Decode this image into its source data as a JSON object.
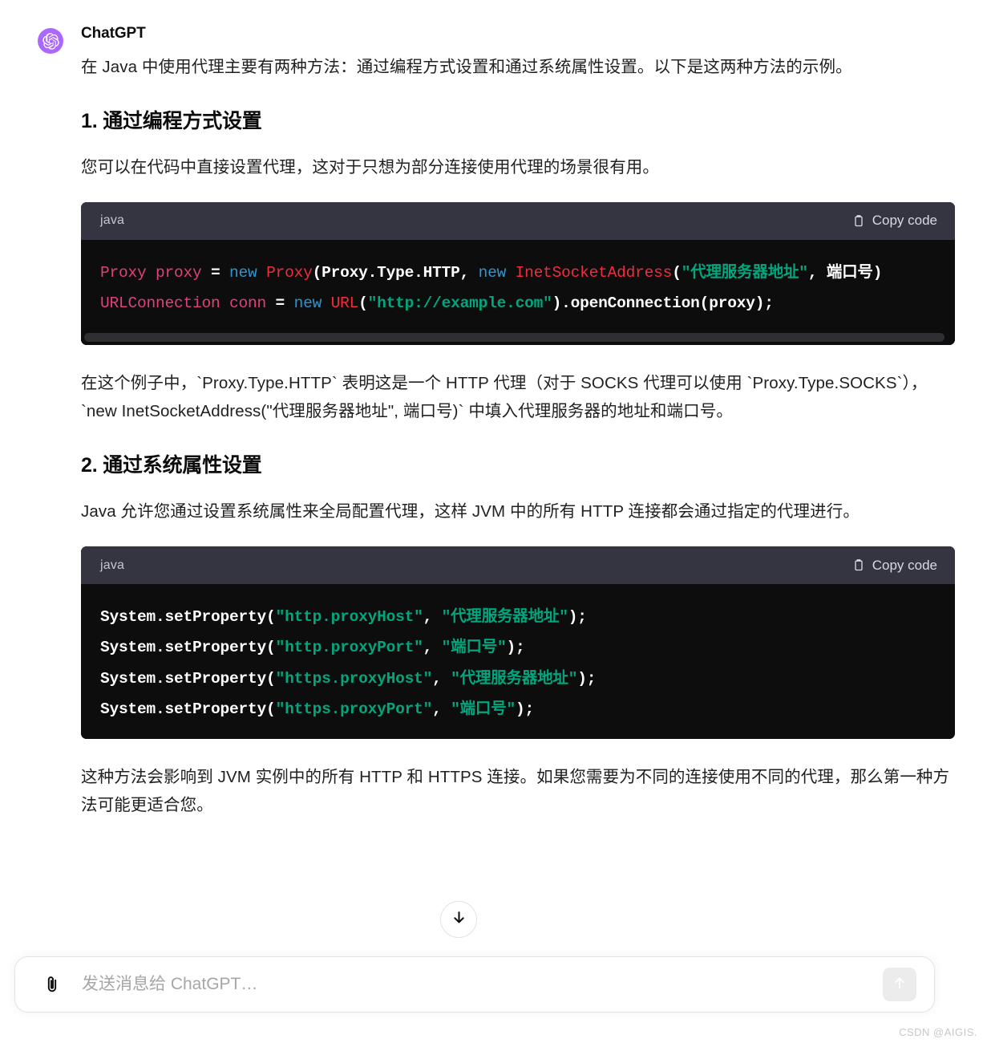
{
  "message": {
    "author": "ChatGPT",
    "avatar_icon": "openai-logo-icon",
    "avatar_color": "#AB68FF",
    "intro_paragraph": "在 Java 中使用代理主要有两种方法：通过编程方式设置和通过系统属性设置。以下是这两种方法的示例。",
    "section1": {
      "heading": "1. 通过编程方式设置",
      "paragraph": "您可以在代码中直接设置代理，这对于只想为部分连接使用代理的场景很有用。",
      "code_block": {
        "language": "java",
        "copy_label": "Copy code",
        "copy_icon": "clipboard-icon",
        "lines": [
          [
            {
              "t": "Proxy ",
              "c": "t-type"
            },
            {
              "t": "proxy ",
              "c": "t-type"
            },
            {
              "t": "= ",
              "c": "t-plain"
            },
            {
              "t": "new ",
              "c": "t-kw"
            },
            {
              "t": "Proxy",
              "c": "t-cls"
            },
            {
              "t": "(Proxy.Type.HTTP, ",
              "c": "t-punct"
            },
            {
              "t": "new ",
              "c": "t-kw"
            },
            {
              "t": "InetSocketAddress",
              "c": "t-cls"
            },
            {
              "t": "(",
              "c": "t-punct"
            },
            {
              "t": "\"代理服务器地址\"",
              "c": "t-str"
            },
            {
              "t": ", 端口号)",
              "c": "t-punct"
            }
          ],
          [
            {
              "t": "URLConnection ",
              "c": "t-type"
            },
            {
              "t": "conn ",
              "c": "t-type"
            },
            {
              "t": "= ",
              "c": "t-plain"
            },
            {
              "t": "new ",
              "c": "t-kw"
            },
            {
              "t": "URL",
              "c": "t-cls"
            },
            {
              "t": "(",
              "c": "t-punct"
            },
            {
              "t": "\"http://example.com\"",
              "c": "t-str"
            },
            {
              "t": ").openConnection(proxy);",
              "c": "t-punct"
            }
          ]
        ],
        "has_scrollbar": true
      },
      "explanation_parts": [
        {
          "type": "text",
          "t": "在这个例子中，"
        },
        {
          "type": "code",
          "t": "`Proxy.Type.HTTP`"
        },
        {
          "type": "text",
          "t": " 表明这是一个 HTTP 代理（对于 SOCKS 代理可以使用 "
        },
        {
          "type": "code",
          "t": "`Proxy.Type.SOCKS`"
        },
        {
          "type": "text",
          "t": "），"
        },
        {
          "type": "code",
          "t": "`new InetSocketAddress(\"代理服务器地址\", 端口号)`"
        },
        {
          "type": "text",
          "t": " 中填入代理服务器的地址和端口号。"
        }
      ]
    },
    "section2": {
      "heading": "2. 通过系统属性设置",
      "paragraph": "Java 允许您通过设置系统属性来全局配置代理，这样 JVM 中的所有 HTTP 连接都会通过指定的代理进行。",
      "code_block": {
        "language": "java",
        "copy_label": "Copy code",
        "copy_icon": "clipboard-icon",
        "lines": [
          [
            {
              "t": "System.setProperty",
              "c": "t-plain"
            },
            {
              "t": "(",
              "c": "t-punct"
            },
            {
              "t": "\"http.proxyHost\"",
              "c": "t-str"
            },
            {
              "t": ", ",
              "c": "t-punct"
            },
            {
              "t": "\"代理服务器地址\"",
              "c": "t-str"
            },
            {
              "t": ");",
              "c": "t-punct"
            }
          ],
          [
            {
              "t": "System.setProperty",
              "c": "t-plain"
            },
            {
              "t": "(",
              "c": "t-punct"
            },
            {
              "t": "\"http.proxyPort\"",
              "c": "t-str"
            },
            {
              "t": ", ",
              "c": "t-punct"
            },
            {
              "t": "\"端口号\"",
              "c": "t-str"
            },
            {
              "t": ");",
              "c": "t-punct"
            }
          ],
          [
            {
              "t": "System.setProperty",
              "c": "t-plain"
            },
            {
              "t": "(",
              "c": "t-punct"
            },
            {
              "t": "\"https.proxyHost\"",
              "c": "t-str"
            },
            {
              "t": ", ",
              "c": "t-punct"
            },
            {
              "t": "\"代理服务器地址\"",
              "c": "t-str"
            },
            {
              "t": ");",
              "c": "t-punct"
            }
          ],
          [
            {
              "t": "System.setProperty",
              "c": "t-plain"
            },
            {
              "t": "(",
              "c": "t-punct"
            },
            {
              "t": "\"https.proxyPort\"",
              "c": "t-str"
            },
            {
              "t": ", ",
              "c": "t-punct"
            },
            {
              "t": "\"端口号\"",
              "c": "t-str"
            },
            {
              "t": ");",
              "c": "t-punct"
            }
          ]
        ],
        "has_scrollbar": false
      },
      "closing_paragraph": "这种方法会影响到 JVM 实例中的所有 HTTP 和 HTTPS 连接。如果您需要为不同的连接使用不同的代理，那么第一种方法可能更适合您。"
    }
  },
  "scroll_down_button": {
    "icon": "arrow-down-icon"
  },
  "composer": {
    "attach_icon": "paperclip-icon",
    "placeholder": "发送消息给 ChatGPT…",
    "value": "",
    "send_icon": "arrow-up-icon"
  },
  "watermark": "CSDN @AIGIS.",
  "colors": {
    "accent": "#AB68FF",
    "code_bg": "#0d0d0d",
    "code_header_bg": "#343541",
    "string": "#00a67d",
    "keyword": "#2e95d3",
    "class": "#f22c3d",
    "type": "#e0407b"
  }
}
